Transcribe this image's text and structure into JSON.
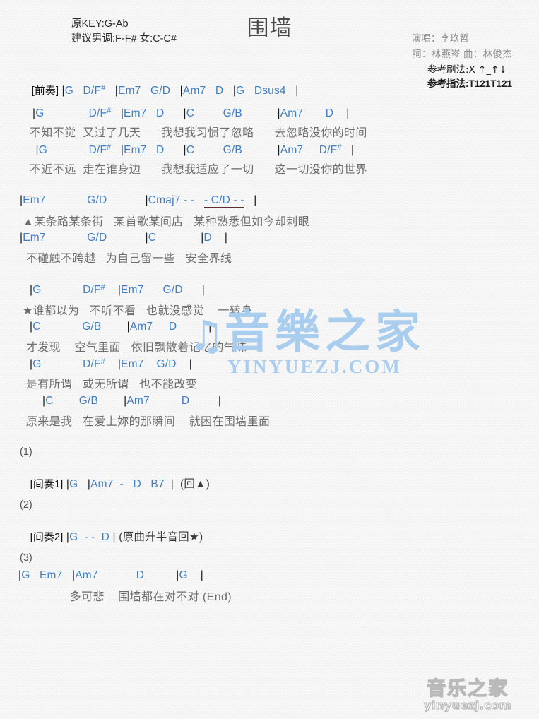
{
  "header": {
    "title": "围墙",
    "original_key": "原KEY:G-Ab",
    "suggested_key": "建议男调:F-F# 女:C-C#",
    "singer": "演唱：李玖哲",
    "writers": "詞：林燕岑  曲：林俊杰",
    "strum_pattern": "参考刷法:X ↑_↑↓",
    "finger_pattern": "参考指法:T121T121"
  },
  "intro": {
    "label": "[前奏]",
    "chords": "|G    D/F#    |Em7    G/D    |Am7    D    |G    Dsus4    |"
  },
  "sections": [
    {
      "name": "verse-1",
      "lines": [
        {
          "chords": "|G              D/F#   |Em7   D      |C         G/B           |Am7       D    |",
          "lyrics": "不知不觉  又过了几天      我想我习惯了忽略      去忽略没你的时间"
        },
        {
          "chords": " |G             D/F#   |Em7   D      |C         G/B           |Am7     D/F#   |",
          "lyrics": "不近不远  走在谁身边      我想我适应了一切      这一切没你的世界"
        }
      ]
    },
    {
      "name": "verse-2",
      "lines": [
        {
          "chords": "|Em7             G/D            |Cmaj7 - -    - C/D - -     |",
          "lyrics": "▲某条路某条街   某首歌某间店   某种熟悉但如今却刺眼"
        },
        {
          "chords": "|Em7             G/D            |C              |D    |",
          "lyrics": " 不碰触不跨越   为自己留一些   安全界线"
        }
      ]
    },
    {
      "name": "chorus",
      "lines": [
        {
          "chords": " |G             D/F#    |Em7      G/D      |",
          "lyrics": "★谁都以为   不听不看   也就没感觉    一转身"
        },
        {
          "chords": " |C             G/B        |Am7     D          |",
          "lyrics": " 才发现    空气里面   依旧飘散着记忆的气味"
        },
        {
          "chords": " |G             D/F#    |Em7    G/D    |",
          "lyrics": " 是有所谓   或无所谓   也不能改变"
        },
        {
          "chords": "     |C        G/B        |Am7          D         |",
          "lyrics": " 原来是我   在爱上妳的那瞬间    就困在围墙里面"
        }
      ]
    }
  ],
  "endings": [
    {
      "number": "(1)",
      "label": "[间奏1]",
      "chords": "|G    |Am7   -    D    B7   |  (回▲)"
    },
    {
      "number": "(2)",
      "label": "[间奏2]",
      "chords": "|G   - -   D  |  (原曲升半音回★)"
    },
    {
      "number": "(3)",
      "label": "",
      "chords": "|G   Em7   |Am7            D          |G    |",
      "lyrics": "               多可悲    围墙都在对不对 (End)"
    }
  ],
  "watermark": {
    "center_cjk": "音樂之家",
    "center_latin": "YINYUEZJ.COM",
    "corner_cjk": "音乐之家",
    "corner_latin": "yinyuezj.com"
  }
}
